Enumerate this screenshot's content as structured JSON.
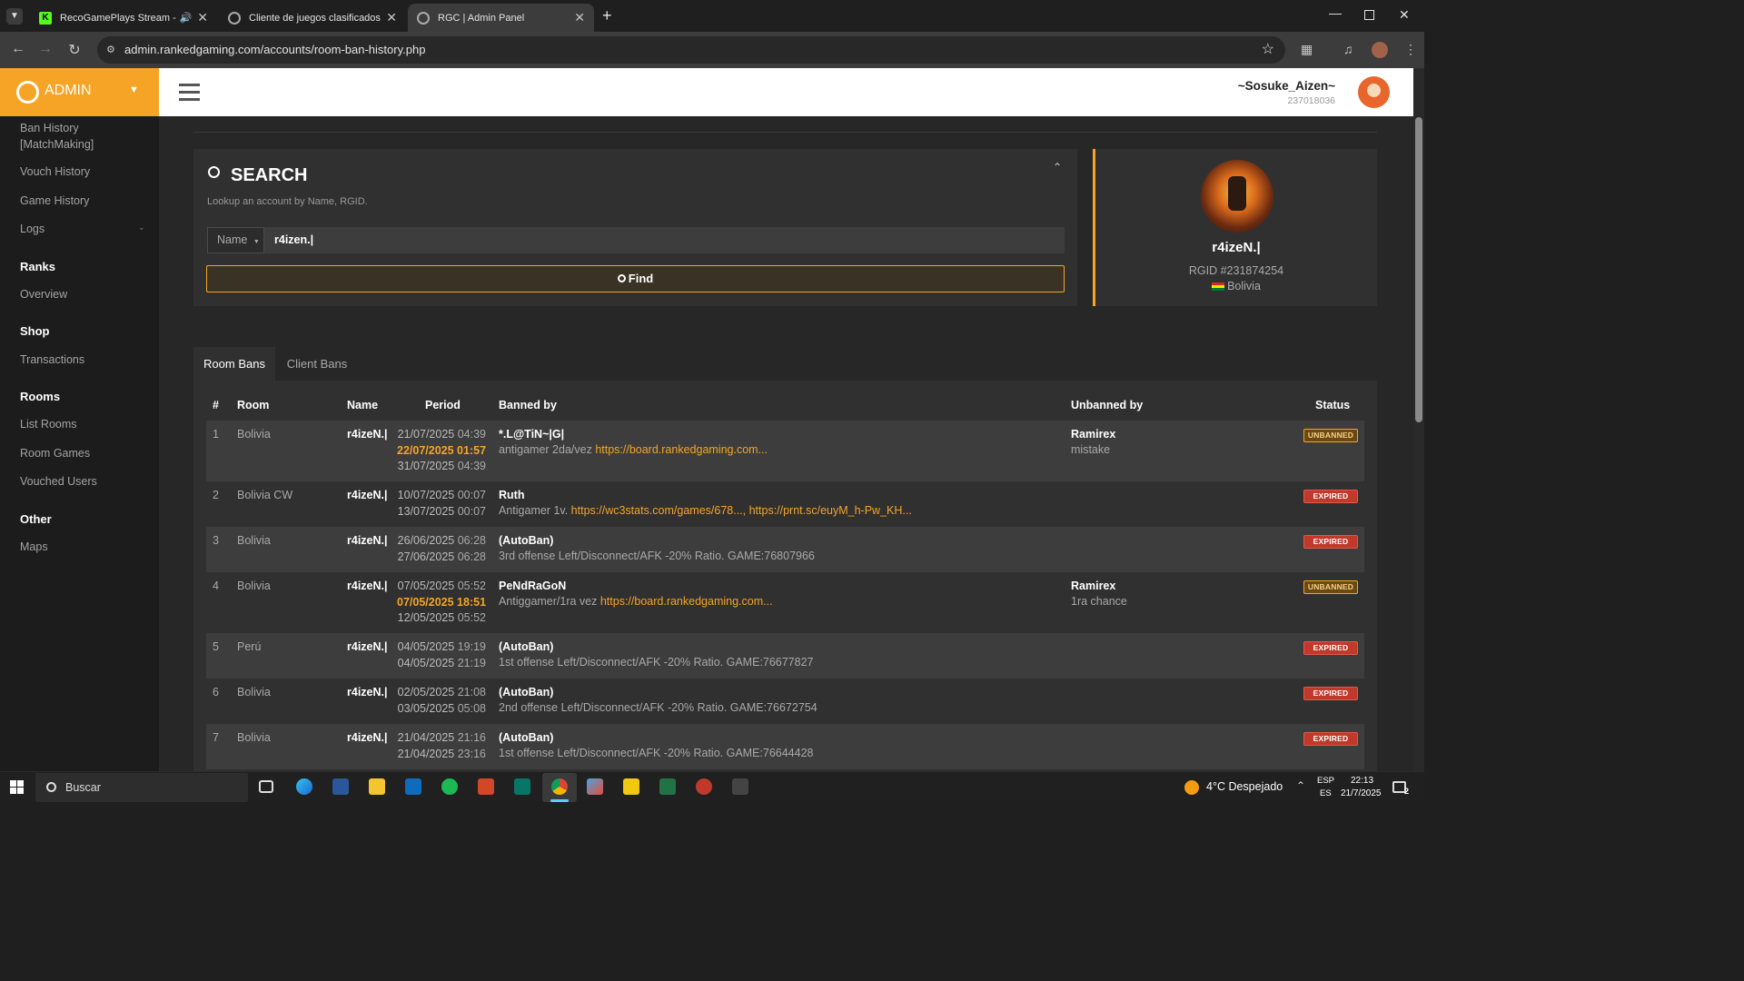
{
  "browser": {
    "tabs": [
      {
        "title": "RecoGamePlays Stream - Watc",
        "active": false
      },
      {
        "title": "Cliente de juegos clasificados",
        "active": false
      },
      {
        "title": "RGC | Admin Panel",
        "active": true
      }
    ],
    "url": "admin.rankedgaming.com/accounts/room-ban-history.php"
  },
  "brand": {
    "label": "ADMIN"
  },
  "user": {
    "name": "~Sosuke_Aizen~",
    "id": "237018036"
  },
  "sidebar": {
    "items_top": [
      {
        "label": "Ban History [MatchMaking]"
      },
      {
        "label": "Vouch History"
      },
      {
        "label": "Game History"
      },
      {
        "label": "Logs"
      }
    ],
    "ranks": {
      "title": "Ranks",
      "items": [
        "Overview"
      ]
    },
    "shop": {
      "title": "Shop",
      "items": [
        "Transactions"
      ]
    },
    "rooms": {
      "title": "Rooms",
      "items": [
        "List Rooms",
        "Room Games",
        "Vouched Users"
      ]
    },
    "other": {
      "title": "Other",
      "items": [
        "Maps"
      ]
    }
  },
  "search": {
    "title": "SEARCH",
    "subtitle": "Lookup an account by Name, RGID.",
    "filter": "Name",
    "value": "r4izen.|",
    "find_label": "Find"
  },
  "profile": {
    "name": "r4izeN.|",
    "rgid": "RGID #231874254",
    "country": "Bolivia"
  },
  "tabs": [
    "Room Bans",
    "Client Bans"
  ],
  "table": {
    "headers": {
      "num": "#",
      "room": "Room",
      "name": "Name",
      "period": "Period",
      "banned_by": "Banned by",
      "unbanned_by": "Unbanned by",
      "status": "Status"
    },
    "rows": [
      {
        "num": "1",
        "room": "Bolivia",
        "name": "r4izeN.|",
        "d1": "21/07/2025",
        "t1": "04:39",
        "d2": "22/07/2025",
        "t2": "01:57",
        "d3": "31/07/2025",
        "t3": "04:39",
        "by": "*.L@TiN~|G|",
        "reason": "antigamer 2da/vez ",
        "links": "https://board.rankedgaming.com...",
        "unby": "Ramirex",
        "unreason": "mistake",
        "status": "UNBANNED"
      },
      {
        "num": "2",
        "room": "Bolivia CW",
        "name": "r4izeN.|",
        "d1": "10/07/2025",
        "t1": "00:07",
        "d2": "13/07/2025",
        "t2": "00:07",
        "by": "Ruth",
        "reason": "Antigamer 1v. ",
        "links": "https://wc3stats.com/games/678..., https://prnt.sc/euyM_h-Pw_KH...",
        "status": "EXPIRED"
      },
      {
        "num": "3",
        "room": "Bolivia",
        "name": "r4izeN.|",
        "d1": "26/06/2025",
        "t1": "06:28",
        "d2": "27/06/2025",
        "t2": "06:28",
        "by": "(AutoBan)",
        "reason": "3rd offense Left/Disconnect/AFK -20% Ratio. GAME:76807966",
        "status": "EXPIRED"
      },
      {
        "num": "4",
        "room": "Bolivia",
        "name": "r4izeN.|",
        "d1": "07/05/2025",
        "t1": "05:52",
        "d2": "07/05/2025",
        "t2": "18:51",
        "d3": "12/05/2025",
        "t3": "05:52",
        "by": "PeNdRaGoN",
        "reason": "Antiggamer/1ra vez ",
        "links": "https://board.rankedgaming.com...",
        "unby": "Ramirex",
        "unreason": "1ra chance",
        "status": "UNBANNED"
      },
      {
        "num": "5",
        "room": "Perú",
        "name": "r4izeN.|",
        "d1": "04/05/2025",
        "t1": "19:19",
        "d2": "04/05/2025",
        "t2": "21:19",
        "by": "(AutoBan)",
        "reason": "1st offense Left/Disconnect/AFK -20% Ratio. GAME:76677827",
        "status": "EXPIRED"
      },
      {
        "num": "6",
        "room": "Bolivia",
        "name": "r4izeN.|",
        "d1": "02/05/2025",
        "t1": "21:08",
        "d2": "03/05/2025",
        "t2": "05:08",
        "by": "(AutoBan)",
        "reason": "2nd offense Left/Disconnect/AFK -20% Ratio. GAME:76672754",
        "status": "EXPIRED"
      },
      {
        "num": "7",
        "room": "Bolivia",
        "name": "r4izeN.|",
        "d1": "21/04/2025",
        "t1": "21:16",
        "d2": "21/04/2025",
        "t2": "23:16",
        "by": "(AutoBan)",
        "reason": "1st offense Left/Disconnect/AFK -20% Ratio. GAME:76644428",
        "status": "EXPIRED"
      }
    ]
  },
  "taskbar": {
    "search_placeholder": "Buscar",
    "weather": "4°C Despejado",
    "lang": "ESP",
    "region": "ES",
    "time": "22:13",
    "date": "21/7/2025",
    "notif_count": "2"
  },
  "colors": {
    "accent": "#f5a425",
    "expired": "#c0392b",
    "bg": "#272727"
  }
}
